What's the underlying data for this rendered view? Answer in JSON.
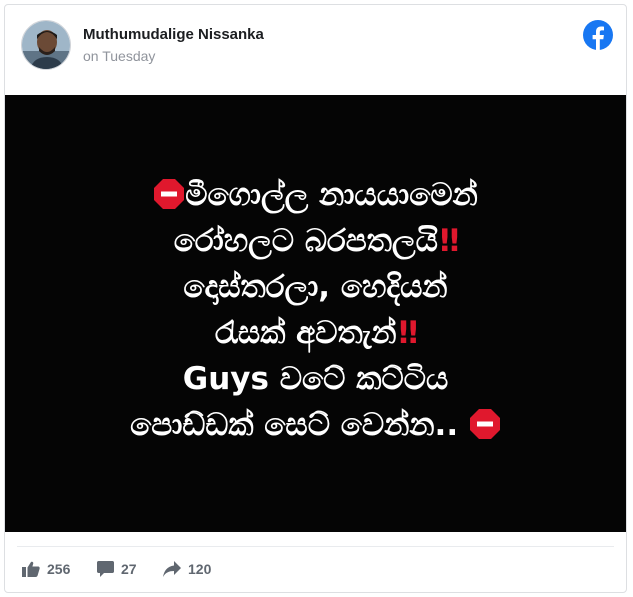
{
  "post": {
    "author": "Muthumudalige Nissanka",
    "timestamp": "on Tuesday",
    "text_lines": [
      "මීගොල්ල නායයාමෙන්",
      "රෝහලට බරපතලයි",
      "දොස්තරලා, හෙදියන්",
      "රැසක් අවතැන්",
      "Guys වටේ කට්ටිය",
      "පොඩ්ඩක් සෙට් වෙන්න.."
    ],
    "emphasis_mark": "‼"
  },
  "stats": {
    "likes": "256",
    "comments": "27",
    "shares": "120"
  },
  "colors": {
    "facebook_blue": "#1877f2",
    "stop_red": "#e0182d",
    "image_background": "#050505"
  }
}
